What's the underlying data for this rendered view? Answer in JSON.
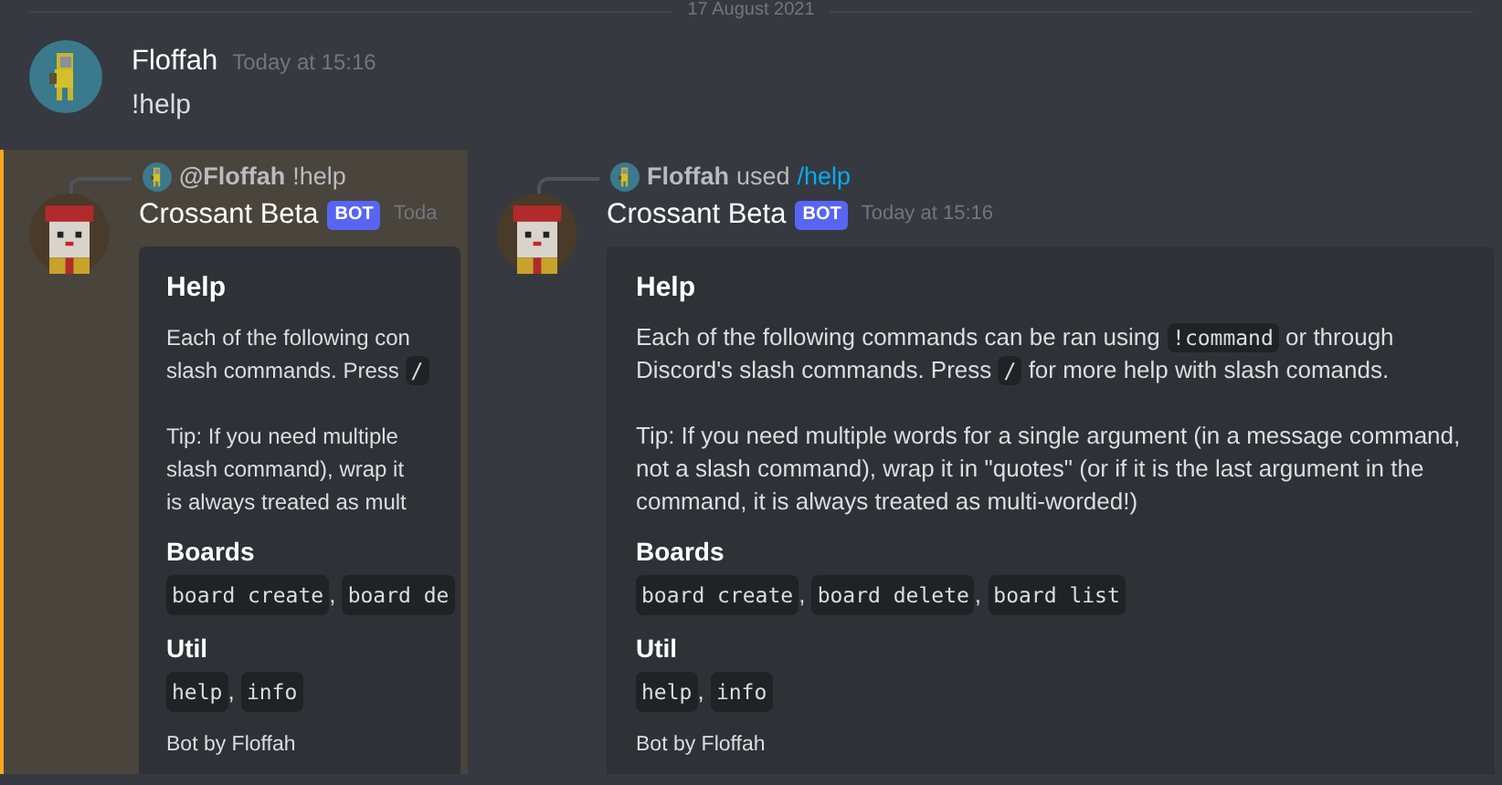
{
  "date_divider": "17 August 2021",
  "user_message": {
    "author": "Floffah",
    "timestamp": "Today at 15:16",
    "content": "!help"
  },
  "reply_message": {
    "highlighted": true,
    "reply": {
      "mention": "@Floffah",
      "content": "!help"
    },
    "author": "Crossant Beta",
    "badge": "BOT",
    "timestamp": "Toda",
    "embed": {
      "title": "Help",
      "line_groups": [
        [
          [
            {
              "text": "Each of the following con"
            }
          ],
          [
            {
              "text": "slash commands. Press "
            },
            {
              "code": "/"
            }
          ]
        ],
        [
          [
            {
              "text": "Tip: If you need multiple"
            }
          ],
          [
            {
              "text": "slash command), wrap it"
            }
          ],
          [
            {
              "text": "is always treated as mult"
            }
          ]
        ]
      ],
      "fields": [
        {
          "name": "Boards",
          "value": [
            {
              "code": "board create"
            },
            {
              "text": ", "
            },
            {
              "code": "board de"
            }
          ]
        },
        {
          "name": "Util",
          "value": [
            {
              "code": "help"
            },
            {
              "text": ", "
            },
            {
              "code": "info"
            }
          ]
        }
      ],
      "footer": "Bot by Floffah"
    }
  },
  "slash_message": {
    "highlighted": false,
    "reply": {
      "user": "Floffah",
      "verb": "used",
      "command": "/help"
    },
    "author": "Crossant Beta",
    "badge": "BOT",
    "timestamp": "Today at 15:16",
    "embed": {
      "title": "Help",
      "paragraphs": [
        [
          {
            "text": "Each of the following commands can be ran using "
          },
          {
            "code": "!command"
          },
          {
            "text": " or through Discord's slash commands. Press "
          },
          {
            "code": "/"
          },
          {
            "text": " for more help with slash comands."
          }
        ],
        [
          {
            "text": "Tip: If you need multiple words for a single argument (in a message command, not a slash command), wrap it in \"quotes\" (or if it is the last argument in the command, it is always treated as multi-worded!)"
          }
        ]
      ],
      "fields": [
        {
          "name": "Boards",
          "value": [
            {
              "code": "board create"
            },
            {
              "text": ", "
            },
            {
              "code": "board delete"
            },
            {
              "text": ", "
            },
            {
              "code": "board list"
            }
          ]
        },
        {
          "name": "Util",
          "value": [
            {
              "code": "help"
            },
            {
              "text": ", "
            },
            {
              "code": "info"
            }
          ]
        }
      ],
      "footer": "Bot by Floffah"
    }
  }
}
